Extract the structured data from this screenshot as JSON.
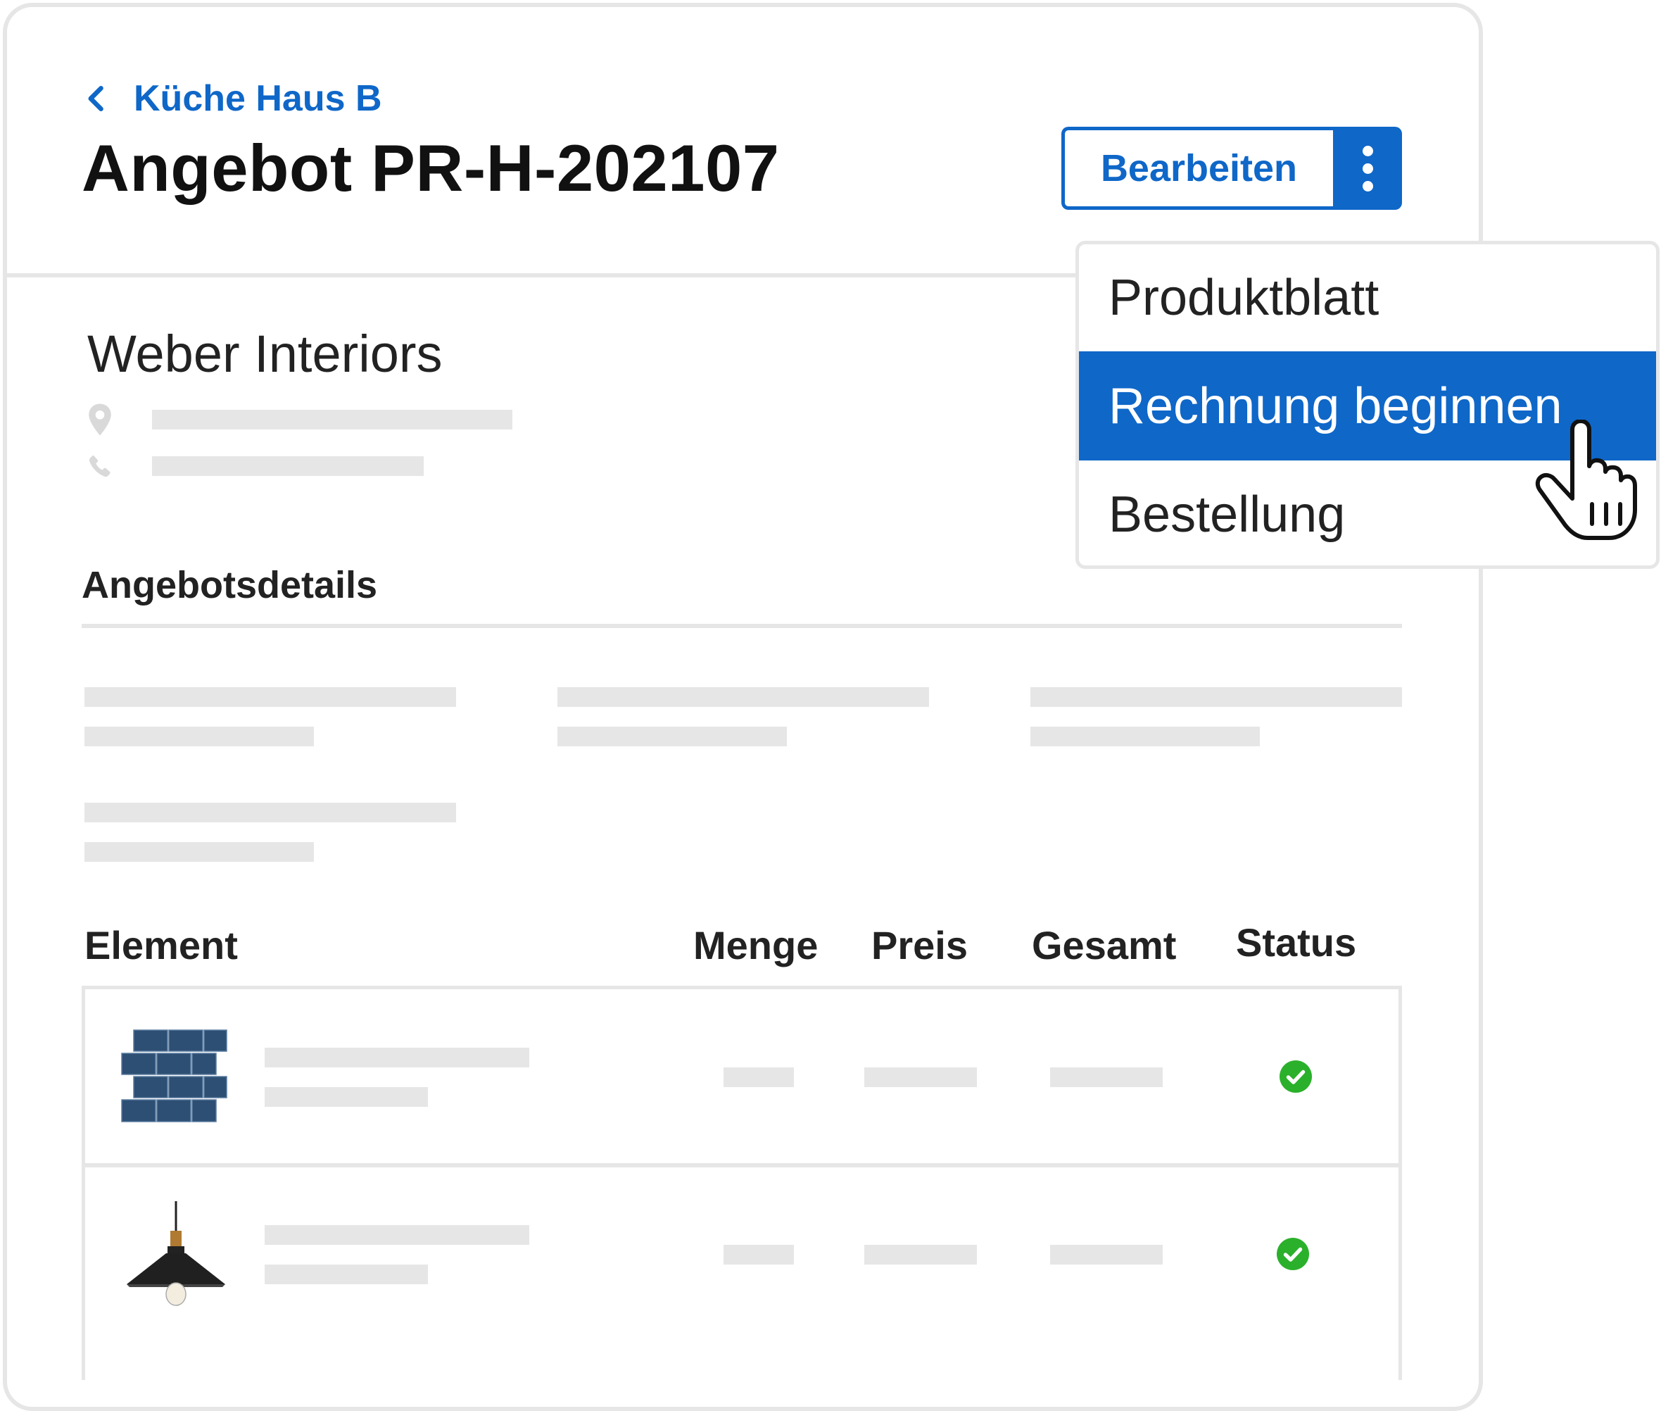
{
  "header": {
    "back_label": "Küche Haus B",
    "title": "Angebot PR-H-202107",
    "edit_label": "Bearbeiten"
  },
  "menu": {
    "items": [
      {
        "label": "Produktblatt",
        "active": false
      },
      {
        "label": "Rechnung beginnen",
        "active": true
      },
      {
        "label": "Bestellung",
        "active": false
      }
    ]
  },
  "company": {
    "name": "Weber Interiors"
  },
  "details": {
    "title": "Angebotsdetails"
  },
  "table": {
    "headers": [
      "Element",
      "Menge",
      "Preis",
      "Gesamt",
      "Status"
    ],
    "rows": [
      {
        "thumbnail": "blue-brick-tiles",
        "status": "check-icon"
      },
      {
        "thumbnail": "pendant-lamp",
        "status": "check-icon"
      }
    ]
  },
  "colors": {
    "accent": "#0f67c8",
    "placeholder": "#e6e6e6",
    "status_ok": "#2bb02b"
  }
}
